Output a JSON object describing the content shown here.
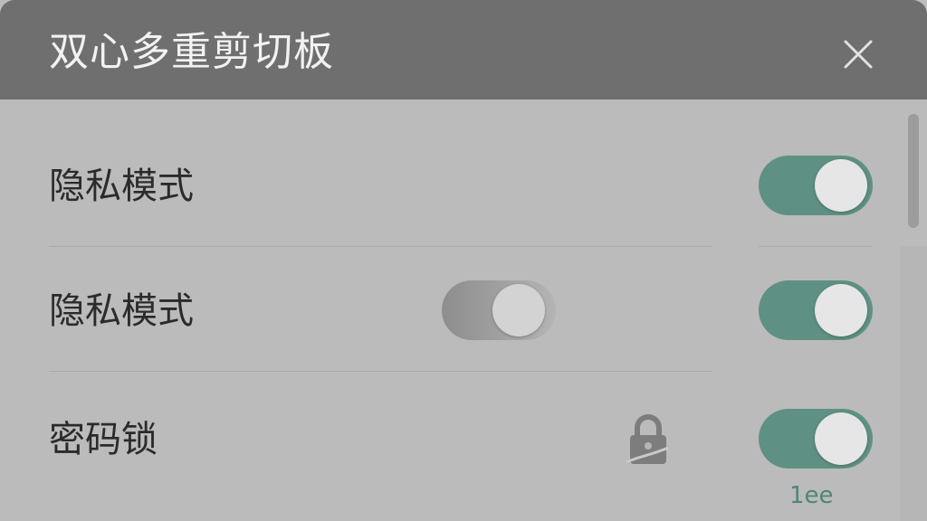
{
  "window": {
    "title": "双心多重剪切板",
    "close_icon": "close-icon"
  },
  "settings": [
    {
      "label": "隐私模式",
      "toggle_on": true
    },
    {
      "label": "隐私模式",
      "inline_toggle_on": false,
      "toggle_on": true
    },
    {
      "label": "密码锁",
      "icon": "lock-icon",
      "toggle_on": true,
      "caption": "1ee"
    }
  ],
  "colors": {
    "titlebar": "#6f6f6f",
    "background": "#bbbbbb",
    "toggle_on": "#5f9084",
    "toggle_knob": "#e6e6e6"
  }
}
